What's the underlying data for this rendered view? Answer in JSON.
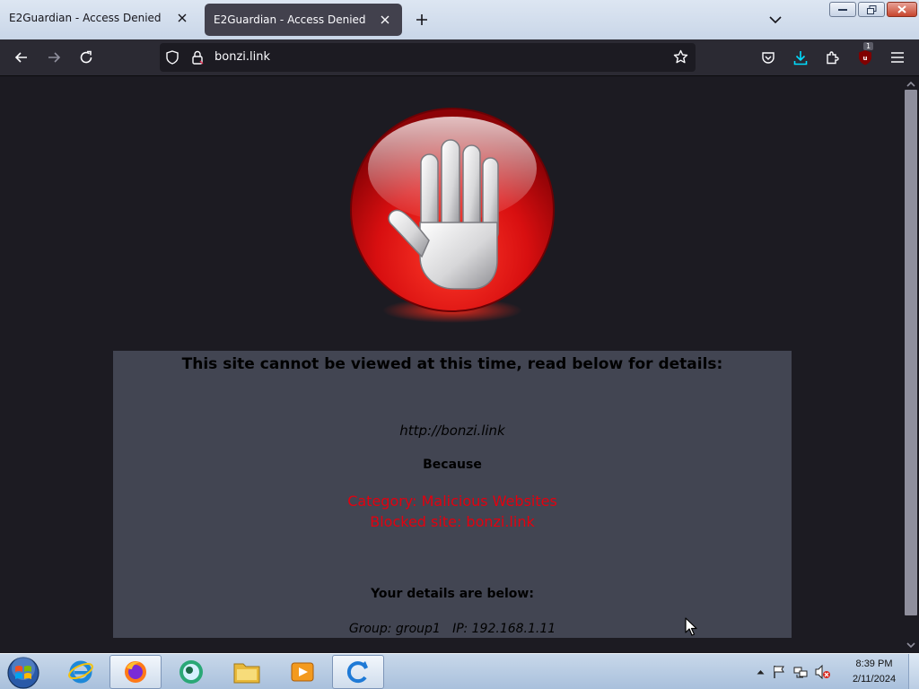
{
  "browser": {
    "tabs": [
      {
        "label": "E2Guardian - Access Denied",
        "active": false
      },
      {
        "label": "E2Guardian - Access Denied",
        "active": true
      }
    ],
    "address": "bonzi.link",
    "extension_badge": "1"
  },
  "page": {
    "headline": "This site cannot be viewed at this time, read below for details:",
    "blocked_url": "http://bonzi.link",
    "because_label": "Because",
    "category_line": "Category: Malicious Websites",
    "blocked_site_line": "Blocked site: bonzi.link",
    "details_heading": "Your details are below:",
    "details_line": "Group: group1   IP: 192.168.1.11"
  },
  "taskbar": {
    "apps": [
      {
        "name": "internet-explorer",
        "active": false
      },
      {
        "name": "firefox",
        "active": true
      },
      {
        "name": "messenger",
        "active": false
      },
      {
        "name": "file-explorer",
        "active": false
      },
      {
        "name": "media-player",
        "active": false
      },
      {
        "name": "update-tool",
        "active": true
      }
    ],
    "time": "8:39 PM",
    "date": "2/11/2024"
  },
  "colors": {
    "accent_red": "#e3000f",
    "panel_bg": "#424552",
    "page_bg": "#1c1b22"
  }
}
